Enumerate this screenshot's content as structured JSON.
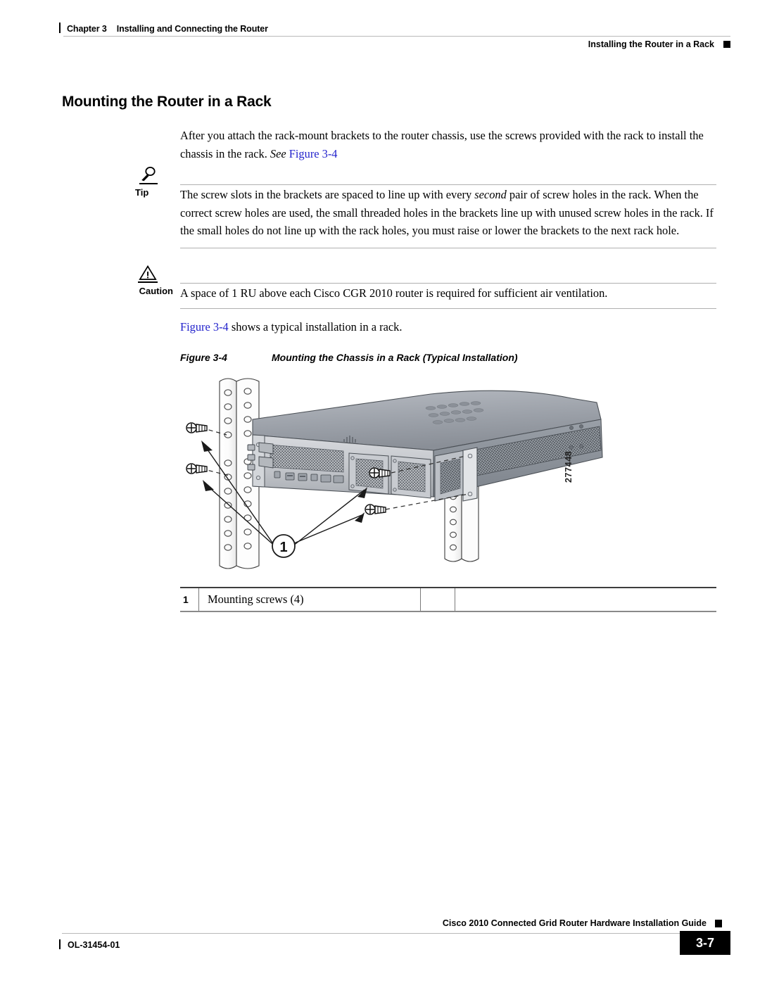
{
  "header": {
    "chapter": "Chapter 3",
    "chapter_title": "Installing and Connecting the Router",
    "running_head": "Installing the Router in a Rack"
  },
  "heading": "Mounting the Router in a Rack",
  "intro": {
    "text_before": "After you attach the rack-mount brackets to the router chassis, use the screws provided with the rack to install the chassis in the rack. ",
    "see_italic": "See",
    "link": "Figure 3-4"
  },
  "tip": {
    "label": "Tip",
    "icon": "magnifier-icon",
    "text": "The screw slots in the brackets are spaced to line up with every ",
    "emphasis": "second",
    "text_after": " pair of screw holes in the rack. When the correct screw holes are used, the small threaded holes in the brackets line up with unused screw holes in the rack. If the small holes do not line up with the rack holes, you must raise or lower the brackets to the next rack hole."
  },
  "caution": {
    "label": "Caution",
    "icon": "warning-triangle-icon",
    "text": "A space of 1 RU above each Cisco CGR 2010 router is required for sufficient air ventilation."
  },
  "figure_ref": {
    "link": "Figure 3-4",
    "text": " shows a typical installation in a rack."
  },
  "figure": {
    "number": "Figure 3-4",
    "title": "Mounting the Chassis in a Rack (Typical Installation)",
    "art_id": "277448",
    "callout_number": "1",
    "alt": "Illustration of a Cisco CGR 2010 router chassis being mounted between two vertical rack rails with four mounting screws indicated by dashed leader lines."
  },
  "legend": {
    "rows": [
      {
        "num": "1",
        "text": "Mounting screws (4)"
      }
    ]
  },
  "footer": {
    "doc_id": "OL-31454-01",
    "guide_title": "Cisco 2010 Connected Grid Router Hardware Installation Guide",
    "page_number": "3-7"
  },
  "colors": {
    "link": "#2222cc",
    "rule": "#b9b9b9",
    "chassis_top": "#9a9ea6",
    "chassis_front": "#c6c8cc",
    "rail": "#ffffff"
  }
}
